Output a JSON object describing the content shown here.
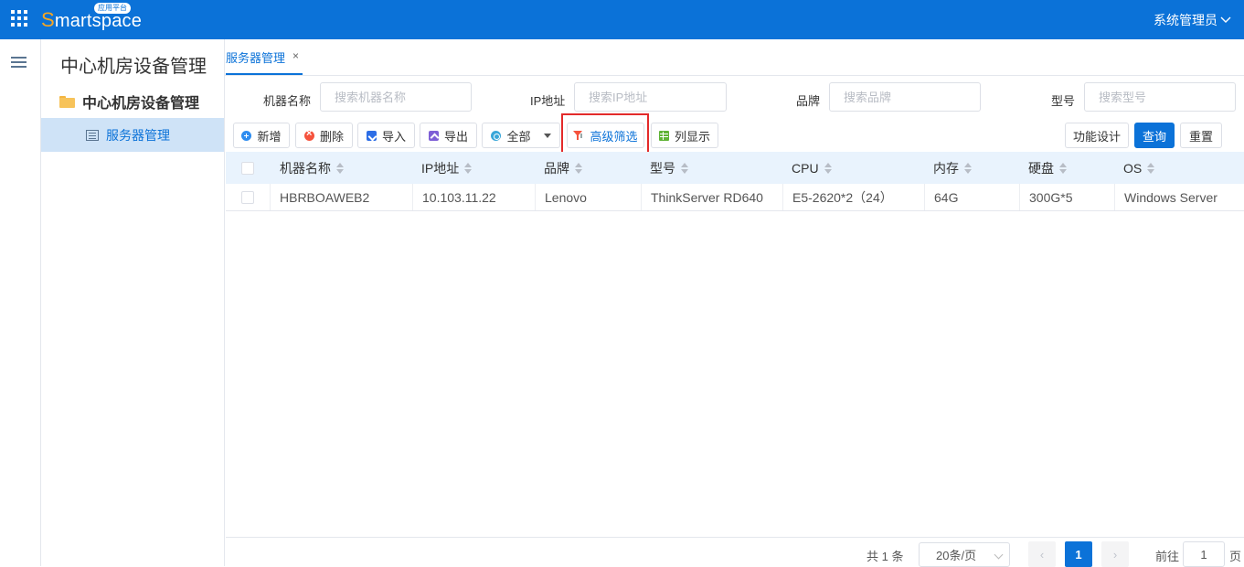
{
  "header": {
    "logo_first_letter": "S",
    "logo_rest": "martspace",
    "logo_badge": "应用平台",
    "user": "系统管理员"
  },
  "sidebar": {
    "title": "中心机房设备管理",
    "root": "中心机房设备管理",
    "leaf": "服务器管理"
  },
  "tabs": [
    {
      "label": "服务器管理",
      "close": "×"
    }
  ],
  "search": {
    "name_label": "机器名称",
    "name_placeholder": "搜索机器名称",
    "ip_label": "IP地址",
    "ip_placeholder": "搜索IP地址",
    "brand_label": "品牌",
    "brand_placeholder": "搜索品牌",
    "model_label": "型号",
    "model_placeholder": "搜索型号"
  },
  "toolbar": {
    "add": "新增",
    "delete": "删除",
    "import": "导入",
    "export": "导出",
    "all": "全部",
    "advanced_filter": "高级筛选",
    "columns": "列显示",
    "design": "功能设计",
    "query": "查询",
    "reset": "重置"
  },
  "table": {
    "columns": [
      "机器名称",
      "IP地址",
      "品牌",
      "型号",
      "CPU",
      "内存",
      "硬盘",
      "OS"
    ],
    "rows": [
      [
        "HBRBOAWEB2",
        "10.103.11.22",
        "Lenovo",
        "ThinkServer RD640",
        "E5-2620*2（24）",
        "64G",
        "300G*5",
        "Windows Server"
      ]
    ]
  },
  "pagination": {
    "total": "共 1 条",
    "page_size": "20条/页",
    "prev": "‹",
    "current": "1",
    "next": "›",
    "goto_label": "前往",
    "goto_value": "1",
    "page_suffix": "页"
  },
  "colors": {
    "primary": "#0b72d8",
    "header_row": "#e9f3fd",
    "highlight": "#e32a2a",
    "selected_menu": "#cfe3f7"
  }
}
